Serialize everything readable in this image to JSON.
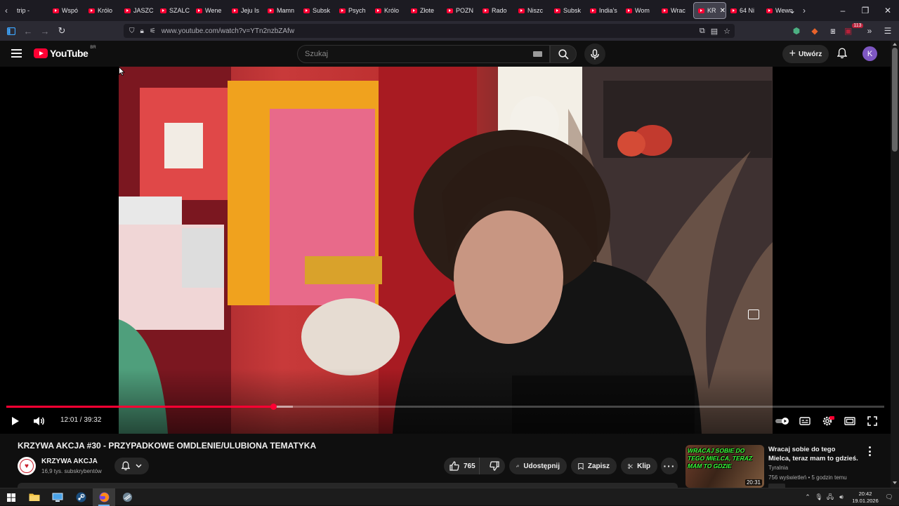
{
  "browser": {
    "tabs": [
      {
        "label": "trip -",
        "favicon": "plain-page-icon"
      },
      {
        "label": "Wspó",
        "favicon": "youtube-icon"
      },
      {
        "label": "Królo",
        "favicon": "youtube-icon"
      },
      {
        "label": "JASZC",
        "favicon": "youtube-icon"
      },
      {
        "label": "SZALC",
        "favicon": "youtube-icon"
      },
      {
        "label": "Wene",
        "favicon": "youtube-icon"
      },
      {
        "label": "Jeju Is",
        "favicon": "youtube-icon"
      },
      {
        "label": "Mamn",
        "favicon": "youtube-icon"
      },
      {
        "label": "Subsk",
        "favicon": "youtube-icon"
      },
      {
        "label": "Psych",
        "favicon": "youtube-icon"
      },
      {
        "label": "Królo",
        "favicon": "youtube-icon"
      },
      {
        "label": "Złote",
        "favicon": "youtube-icon"
      },
      {
        "label": "POZN",
        "favicon": "youtube-icon"
      },
      {
        "label": "Rado",
        "favicon": "youtube-icon"
      },
      {
        "label": "Niszc",
        "favicon": "youtube-icon"
      },
      {
        "label": "Subsk",
        "favicon": "youtube-icon"
      },
      {
        "label": "India's",
        "favicon": "youtube-icon"
      },
      {
        "label": "Wom",
        "favicon": "youtube-icon"
      },
      {
        "label": "Wrac",
        "favicon": "youtube-icon"
      },
      {
        "label": "KR",
        "favicon": "youtube-icon",
        "active": true,
        "close": "✕"
      },
      {
        "label": "64 Ni",
        "favicon": "youtube-icon"
      },
      {
        "label": "Wewn",
        "favicon": "youtube-icon"
      }
    ],
    "url": "www.youtube.com/watch?v=YTn2nzbZAfw",
    "extension_badge": "113"
  },
  "youtube": {
    "logo_text": "YouTube",
    "logo_country": "BR",
    "search_placeholder": "Szukaj",
    "create_label": "Utwórz",
    "avatar_letter": "K"
  },
  "player": {
    "current_time": "12:01",
    "duration": "39:32",
    "time_separator": " / ",
    "progress_fraction": 0.304,
    "buffered_fraction": 0.326
  },
  "video": {
    "title": "KRZYWA AKCJA #30 - PRZYPADKOWE OMDLENIE/ULUBIONA TEMATYKA",
    "channel_name": "KRZYWA AKCJA",
    "subscribers": "16,9 tys. subskrybentów",
    "likes": "765",
    "share_label": "Udostępnij",
    "save_label": "Zapisz",
    "clip_label": "Klip",
    "more_label": "···"
  },
  "recommended": {
    "thumbnail_text": "WRACAJ SOBIE DO TEGO MIELCA, TERAZ MAM TO GDZIE",
    "duration": "20:31",
    "title": "Wracaj sobie do tego Mielca, teraz mam to gdzieś.",
    "channel": "Tyralnia",
    "meta": "756 wyświetleń • 5 godzin temu"
  },
  "taskbar": {
    "time": "20:42",
    "date": "19.01.2026"
  },
  "colors": {
    "youtube_red": "#ff0033",
    "background": "#0f0f0f",
    "chip": "#272727",
    "avatar": "#7e57c2",
    "thumb_text": "#39ff3a"
  }
}
